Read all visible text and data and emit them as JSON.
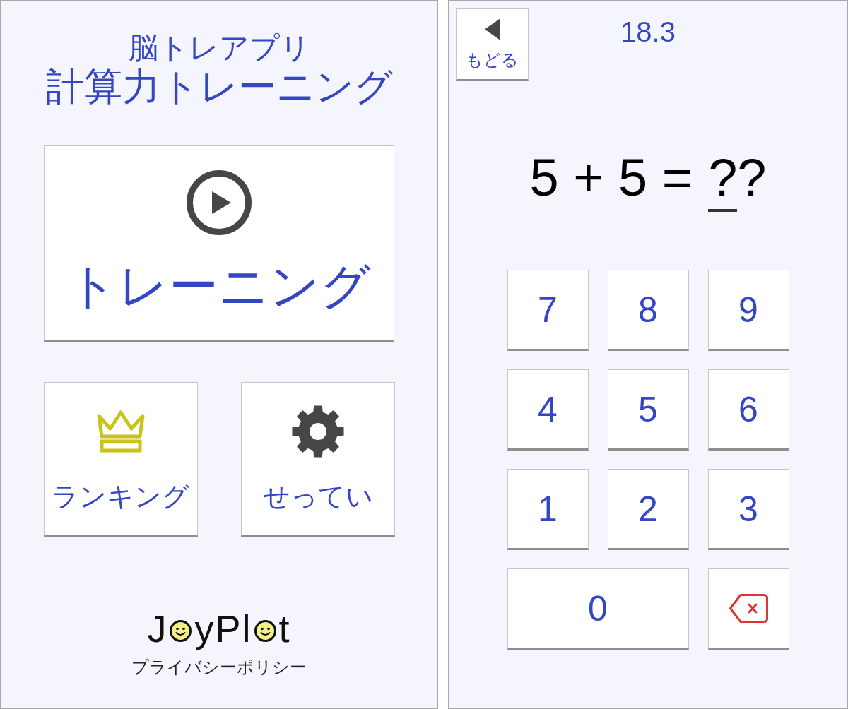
{
  "home_screen": {
    "subtitle": "脳トレアプリ",
    "title": "計算力トレーニング",
    "training_button": {
      "label": "トレーニング"
    },
    "menu_buttons": [
      {
        "kind": "ranking",
        "label": "ランキング"
      },
      {
        "kind": "settings",
        "label": "せってい"
      }
    ],
    "logo": [
      {
        "kind": "text",
        "text": "J"
      },
      {
        "kind": "smiley"
      },
      {
        "kind": "text",
        "text": "yPl"
      },
      {
        "kind": "smiley"
      },
      {
        "kind": "text",
        "text": "t"
      }
    ],
    "privacy_link": "プライバシーポリシー"
  },
  "quiz_screen": {
    "back_button": {
      "label": "もどる"
    },
    "timer": "18.3",
    "equation": {
      "expression": "5 + 5 =",
      "answer_slots": [
        {
          "text": "?",
          "selected": true
        },
        {
          "text": "?",
          "selected": false
        }
      ]
    },
    "keypad": [
      {
        "kind": "digit",
        "label": "7",
        "wide": false
      },
      {
        "kind": "digit",
        "label": "8",
        "wide": false
      },
      {
        "kind": "digit",
        "label": "9",
        "wide": false
      },
      {
        "kind": "digit",
        "label": "4",
        "wide": false
      },
      {
        "kind": "digit",
        "label": "5",
        "wide": false
      },
      {
        "kind": "digit",
        "label": "6",
        "wide": false
      },
      {
        "kind": "digit",
        "label": "1",
        "wide": false
      },
      {
        "kind": "digit",
        "label": "2",
        "wide": false
      },
      {
        "kind": "digit",
        "label": "3",
        "wide": false
      },
      {
        "kind": "digit",
        "label": "0",
        "wide": true
      },
      {
        "kind": "backspace",
        "wide": false
      }
    ]
  }
}
